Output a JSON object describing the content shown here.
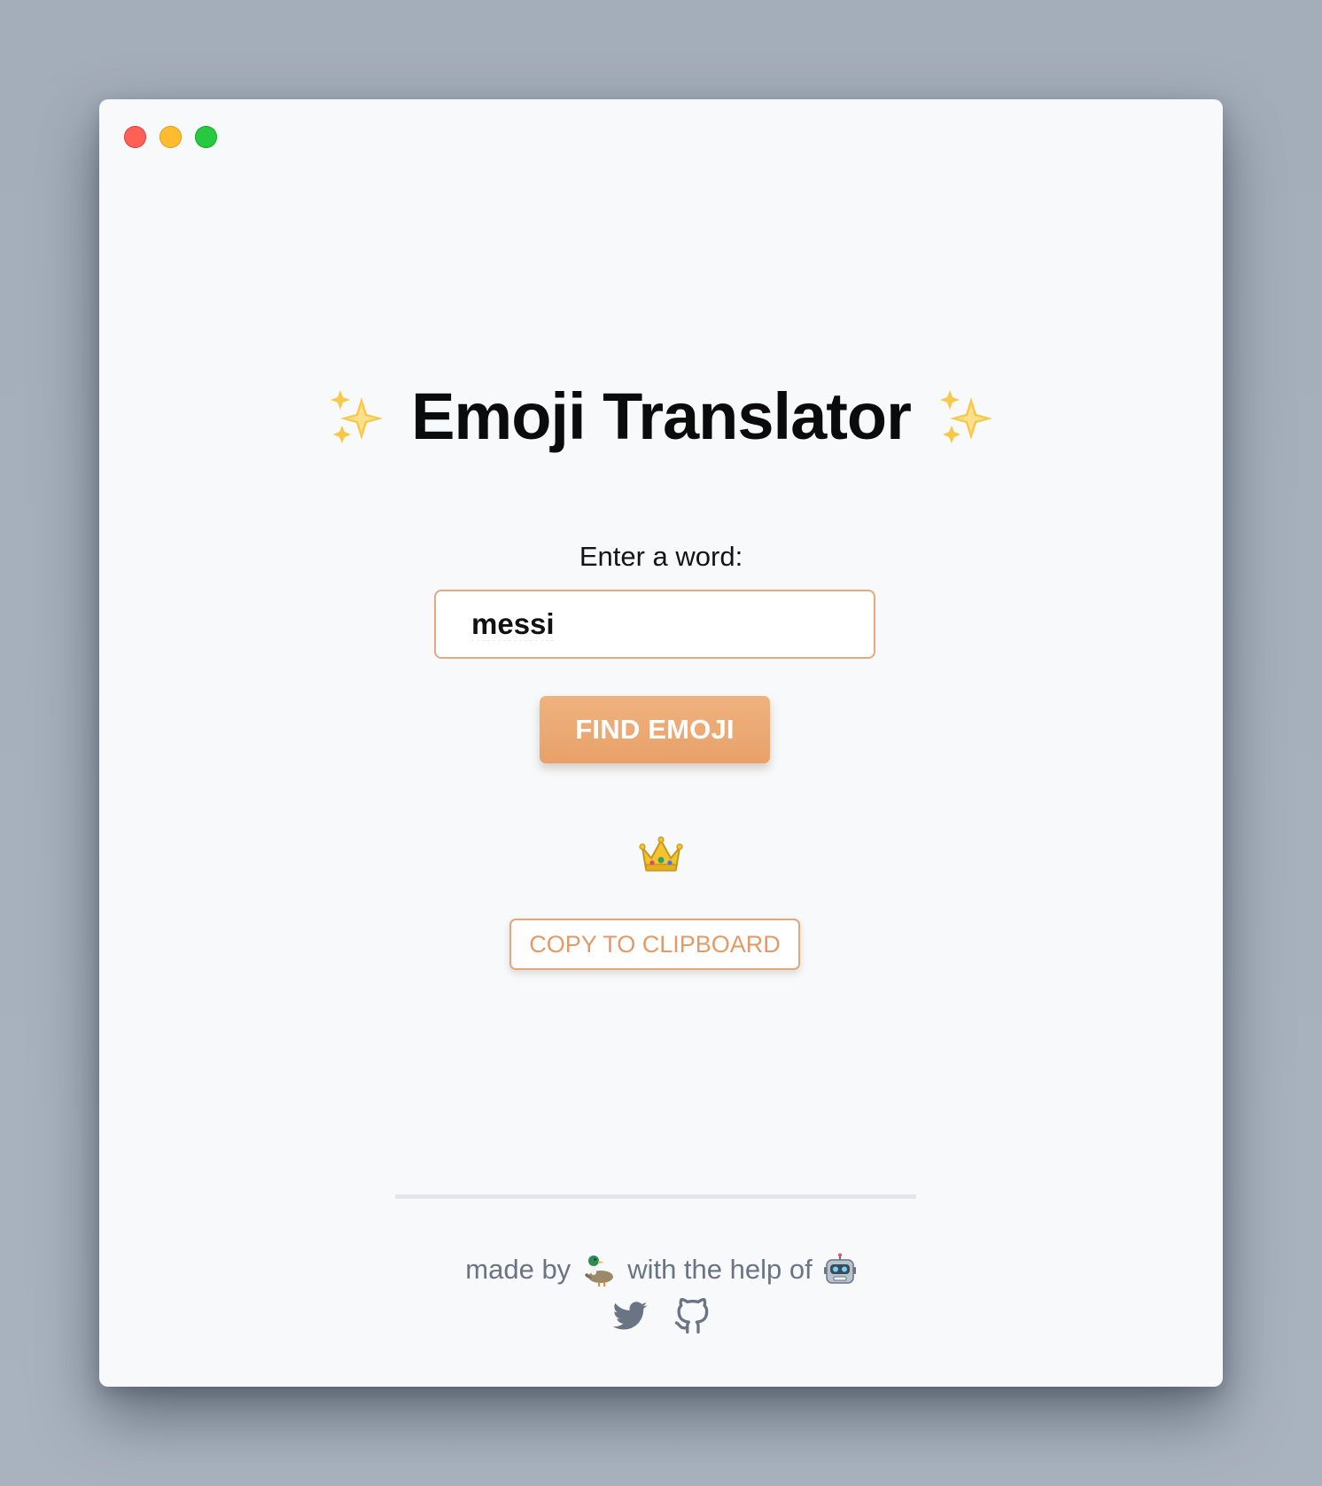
{
  "window": {
    "controls": [
      "close",
      "minimize",
      "maximize"
    ]
  },
  "header": {
    "title": "Emoji Translator",
    "decoration_icon": "sparkles-icon"
  },
  "form": {
    "prompt_label": "Enter a word:",
    "word_value": "messi",
    "find_button_label": "FIND EMOJI"
  },
  "result": {
    "emoji_icon": "crown-icon",
    "copy_button_label": "COPY TO CLIPBOARD"
  },
  "footer": {
    "made_by_text": "made by",
    "made_by_icon": "duck-icon",
    "help_text": "with the help of",
    "help_icon": "robot-icon",
    "links": [
      {
        "name": "twitter-link",
        "icon": "twitter-icon"
      },
      {
        "name": "github-link",
        "icon": "github-icon"
      }
    ]
  },
  "colors": {
    "accent": "#E8A169",
    "accent_text": "#E39A66",
    "muted_text": "#6A7485",
    "window_bg": "#F7F9FB"
  }
}
